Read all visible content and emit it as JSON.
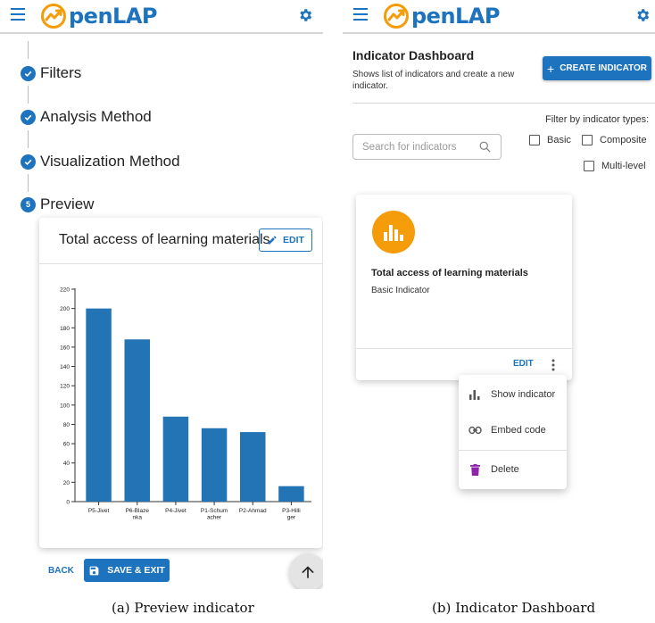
{
  "app": {
    "logo_text": "penLAP",
    "brand_color": "#1e73be"
  },
  "left": {
    "steps": [
      {
        "label": "Filters",
        "state": "completed"
      },
      {
        "label": "Analysis Method",
        "state": "completed"
      },
      {
        "label": "Visualization Method",
        "state": "completed"
      },
      {
        "label": "Preview",
        "state": "active",
        "number": "5"
      }
    ],
    "preview": {
      "title": "Total access of learning materials",
      "edit_label": "EDIT"
    },
    "back_label": "BACK",
    "save_label": "SAVE & EXIT"
  },
  "chart_data": {
    "type": "bar",
    "categories": [
      "P5-Jivet",
      "P6-Blazenka",
      "P4-Jivet",
      "P1-Schumacher",
      "P2-Ahmad",
      "P3-Hilliger"
    ],
    "category_display_lines": [
      [
        "P5-Jivet"
      ],
      [
        "P6-Blaze",
        "nka"
      ],
      [
        "P4-Jivet"
      ],
      [
        "P1-Schum",
        "acher"
      ],
      [
        "P2-Ahmad"
      ],
      [
        "P3-Hilli",
        "ger"
      ]
    ],
    "values": [
      200,
      168,
      88,
      76,
      72,
      16
    ],
    "yticks": [
      0,
      20,
      40,
      60,
      80,
      100,
      120,
      140,
      160,
      180,
      200,
      220
    ],
    "ylim": [
      0,
      220
    ],
    "title": "",
    "xlabel": "",
    "ylabel": "",
    "bar_color": "#2274b5",
    "grid": false
  },
  "right": {
    "dashboard_title": "Indicator Dashboard",
    "dashboard_subtitle": "Shows list of indicators and create a new indicator.",
    "create_label": "CREATE INDICATOR",
    "filter_label": "Filter by indicator types:",
    "search_placeholder": "Search for indicators",
    "filters": [
      {
        "label": "Basic",
        "checked": false
      },
      {
        "label": "Composite",
        "checked": false
      },
      {
        "label": "Multi-level",
        "checked": false
      }
    ],
    "card": {
      "name": "Total access of learning materials",
      "type": "Basic Indicator",
      "edit_label": "EDIT",
      "avatar_color": "#f59c0b"
    },
    "menu": [
      {
        "label": "Show indicator",
        "icon": "bar-chart-icon"
      },
      {
        "label": "Embed code",
        "icon": "link-icon"
      },
      {
        "label": "Delete",
        "icon": "trash-icon",
        "icon_color": "#8e24aa"
      }
    ]
  },
  "captions": {
    "left": "(a) Preview indicator",
    "right": "(b) Indicator Dashboard"
  }
}
